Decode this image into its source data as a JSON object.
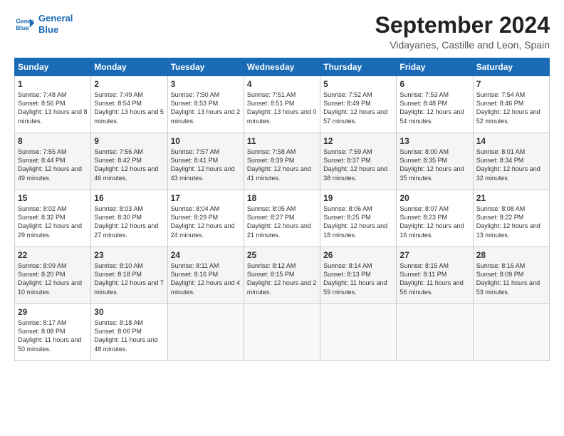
{
  "header": {
    "logo_line1": "General",
    "logo_line2": "Blue",
    "title": "September 2024",
    "subtitle": "Vidayanes, Castille and Leon, Spain"
  },
  "weekdays": [
    "Sunday",
    "Monday",
    "Tuesday",
    "Wednesday",
    "Thursday",
    "Friday",
    "Saturday"
  ],
  "weeks": [
    [
      {
        "day": "1",
        "sunrise": "7:48 AM",
        "sunset": "8:56 PM",
        "daylight": "13 hours and 8 minutes."
      },
      {
        "day": "2",
        "sunrise": "7:49 AM",
        "sunset": "8:54 PM",
        "daylight": "13 hours and 5 minutes."
      },
      {
        "day": "3",
        "sunrise": "7:50 AM",
        "sunset": "8:53 PM",
        "daylight": "13 hours and 2 minutes."
      },
      {
        "day": "4",
        "sunrise": "7:51 AM",
        "sunset": "8:51 PM",
        "daylight": "13 hours and 0 minutes."
      },
      {
        "day": "5",
        "sunrise": "7:52 AM",
        "sunset": "8:49 PM",
        "daylight": "12 hours and 57 minutes."
      },
      {
        "day": "6",
        "sunrise": "7:53 AM",
        "sunset": "8:48 PM",
        "daylight": "12 hours and 54 minutes."
      },
      {
        "day": "7",
        "sunrise": "7:54 AM",
        "sunset": "8:46 PM",
        "daylight": "12 hours and 52 minutes."
      }
    ],
    [
      {
        "day": "8",
        "sunrise": "7:55 AM",
        "sunset": "8:44 PM",
        "daylight": "12 hours and 49 minutes."
      },
      {
        "day": "9",
        "sunrise": "7:56 AM",
        "sunset": "8:42 PM",
        "daylight": "12 hours and 46 minutes."
      },
      {
        "day": "10",
        "sunrise": "7:57 AM",
        "sunset": "8:41 PM",
        "daylight": "12 hours and 43 minutes."
      },
      {
        "day": "11",
        "sunrise": "7:58 AM",
        "sunset": "8:39 PM",
        "daylight": "12 hours and 41 minutes."
      },
      {
        "day": "12",
        "sunrise": "7:59 AM",
        "sunset": "8:37 PM",
        "daylight": "12 hours and 38 minutes."
      },
      {
        "day": "13",
        "sunrise": "8:00 AM",
        "sunset": "8:35 PM",
        "daylight": "12 hours and 35 minutes."
      },
      {
        "day": "14",
        "sunrise": "8:01 AM",
        "sunset": "8:34 PM",
        "daylight": "12 hours and 32 minutes."
      }
    ],
    [
      {
        "day": "15",
        "sunrise": "8:02 AM",
        "sunset": "8:32 PM",
        "daylight": "12 hours and 29 minutes."
      },
      {
        "day": "16",
        "sunrise": "8:03 AM",
        "sunset": "8:30 PM",
        "daylight": "12 hours and 27 minutes."
      },
      {
        "day": "17",
        "sunrise": "8:04 AM",
        "sunset": "8:29 PM",
        "daylight": "12 hours and 24 minutes."
      },
      {
        "day": "18",
        "sunrise": "8:05 AM",
        "sunset": "8:27 PM",
        "daylight": "12 hours and 21 minutes."
      },
      {
        "day": "19",
        "sunrise": "8:06 AM",
        "sunset": "8:25 PM",
        "daylight": "12 hours and 18 minutes."
      },
      {
        "day": "20",
        "sunrise": "8:07 AM",
        "sunset": "8:23 PM",
        "daylight": "12 hours and 16 minutes."
      },
      {
        "day": "21",
        "sunrise": "8:08 AM",
        "sunset": "8:22 PM",
        "daylight": "12 hours and 13 minutes."
      }
    ],
    [
      {
        "day": "22",
        "sunrise": "8:09 AM",
        "sunset": "8:20 PM",
        "daylight": "12 hours and 10 minutes."
      },
      {
        "day": "23",
        "sunrise": "8:10 AM",
        "sunset": "8:18 PM",
        "daylight": "12 hours and 7 minutes."
      },
      {
        "day": "24",
        "sunrise": "8:11 AM",
        "sunset": "8:16 PM",
        "daylight": "12 hours and 4 minutes."
      },
      {
        "day": "25",
        "sunrise": "8:12 AM",
        "sunset": "8:15 PM",
        "daylight": "12 hours and 2 minutes."
      },
      {
        "day": "26",
        "sunrise": "8:14 AM",
        "sunset": "8:13 PM",
        "daylight": "11 hours and 59 minutes."
      },
      {
        "day": "27",
        "sunrise": "8:15 AM",
        "sunset": "8:11 PM",
        "daylight": "11 hours and 56 minutes."
      },
      {
        "day": "28",
        "sunrise": "8:16 AM",
        "sunset": "8:09 PM",
        "daylight": "11 hours and 53 minutes."
      }
    ],
    [
      {
        "day": "29",
        "sunrise": "8:17 AM",
        "sunset": "8:08 PM",
        "daylight": "11 hours and 50 minutes."
      },
      {
        "day": "30",
        "sunrise": "8:18 AM",
        "sunset": "8:06 PM",
        "daylight": "11 hours and 48 minutes."
      },
      null,
      null,
      null,
      null,
      null
    ]
  ]
}
